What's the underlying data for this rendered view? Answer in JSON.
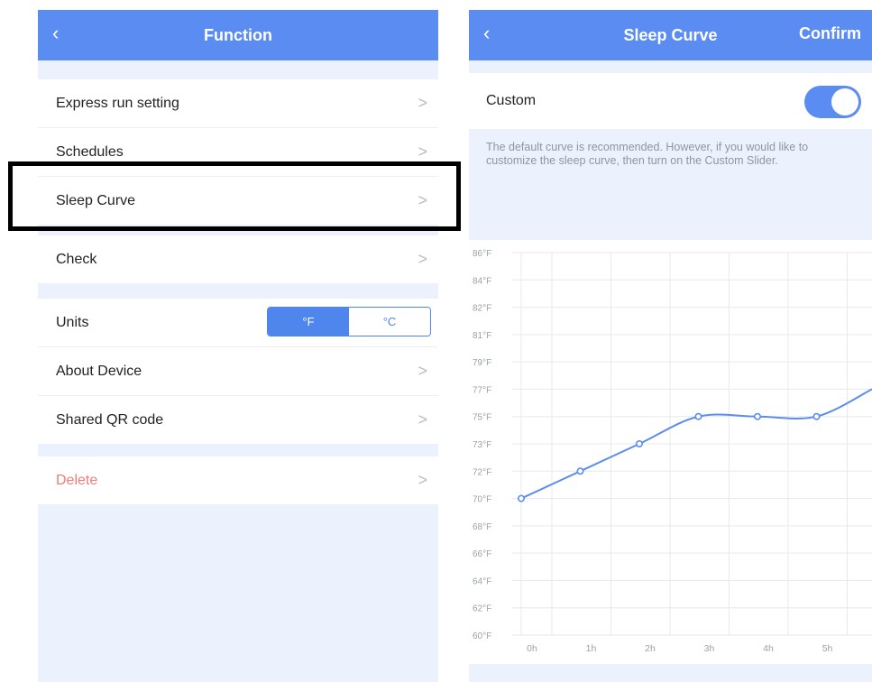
{
  "function_screen": {
    "title": "Function",
    "back_icon": "chevron-left-icon",
    "menu_top": [
      {
        "label": "Express run setting"
      },
      {
        "label": "Schedules"
      },
      {
        "label": "Sleep Curve"
      }
    ],
    "menu_check": {
      "label": "Check"
    },
    "units": {
      "label": "Units",
      "options": [
        "°F",
        "°C"
      ],
      "selected": "°F"
    },
    "about": {
      "label": "About Device"
    },
    "qr": {
      "label": "Shared QR code"
    },
    "delete": {
      "label": "Delete"
    },
    "chevron": ">"
  },
  "sleep_curve_screen": {
    "title": "Sleep Curve",
    "back_icon": "chevron-left-icon",
    "confirm_label": "Confirm",
    "custom": {
      "label": "Custom",
      "enabled": true
    },
    "description": "The default curve is recommended. However, if you would like to customize the sleep curve, then turn on the Custom Slider."
  },
  "colors": {
    "nav_bar": "#5b8cf2",
    "background": "#ebf2fd",
    "accent": "#4f86ed",
    "delete": "#ef7c78"
  },
  "chart_data": {
    "type": "line",
    "y_tick_labels": [
      "60°F",
      "62°F",
      "64°F",
      "66°F",
      "68°F",
      "70°F",
      "72°F",
      "73°F",
      "75°F",
      "77°F",
      "79°F",
      "81°F",
      "82°F",
      "84°F",
      "86°F"
    ],
    "x": [
      "0h",
      "1h",
      "2h",
      "3h",
      "4h",
      "5h"
    ],
    "series": [
      {
        "values": [
          70,
          72,
          73,
          75,
          75,
          75
        ]
      }
    ],
    "right_edge_value": 77,
    "ylim": [
      60,
      86
    ],
    "grid": true,
    "smooth": true,
    "color": "#5b8cf2"
  }
}
